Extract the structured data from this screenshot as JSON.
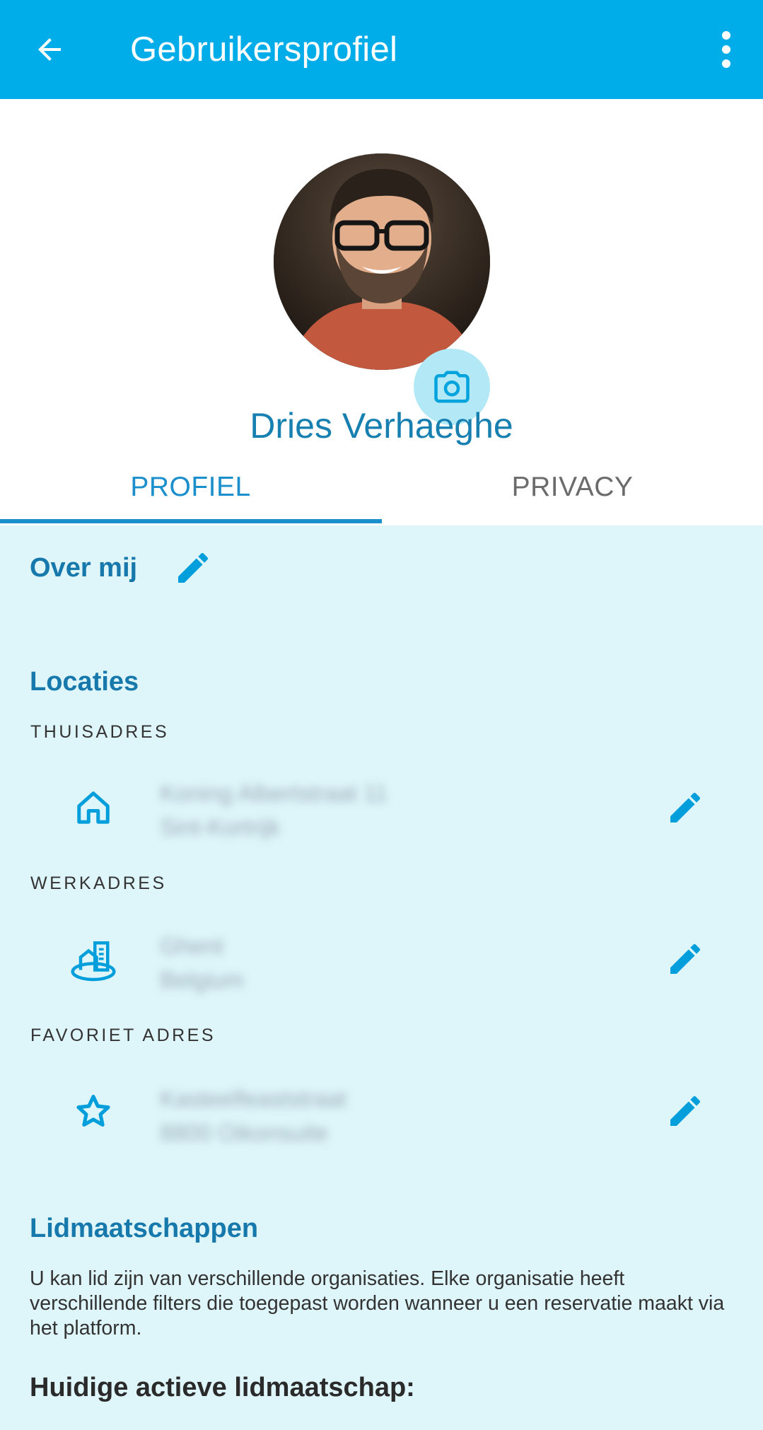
{
  "app_bar": {
    "title": "Gebruikersprofiel",
    "back_icon": "arrow-left-icon",
    "menu_icon": "more-vertical-icon",
    "color": "#00ade9"
  },
  "profile": {
    "name": "Dries Verhaeghe",
    "camera_icon": "camera-icon"
  },
  "tabs": {
    "profile_label": "PROFIEL",
    "privacy_label": "PRIVACY",
    "active": "PROFIEL"
  },
  "about": {
    "title": "Over mij"
  },
  "locations": {
    "title": "Locaties",
    "home": {
      "label": "THUISADRES",
      "line1": "Koning Albertstraat 11",
      "line2": "Sint-Kortrijk",
      "icon": "home-icon"
    },
    "work": {
      "label": "WERKADRES",
      "line1": "Ghent",
      "line2": "Belgium",
      "icon": "office-building-icon"
    },
    "favorite": {
      "label": "FAVORIET ADRES",
      "line1": "Kasteelfeaststraat",
      "line2": "8800 Oikonsuite",
      "icon": "star-icon"
    }
  },
  "memberships": {
    "title": "Lidmaatschappen",
    "description": "U kan lid zijn van verschillende organisaties. Elke organisatie heeft verschillende filters die toegepast worden wanneer u een reservatie maakt via het platform.",
    "active_title": "Huidige actieve lidmaatschap:"
  },
  "colors": {
    "accent": "#1a8fcb",
    "title_blue": "#1779ab",
    "background": "#def5fa"
  }
}
